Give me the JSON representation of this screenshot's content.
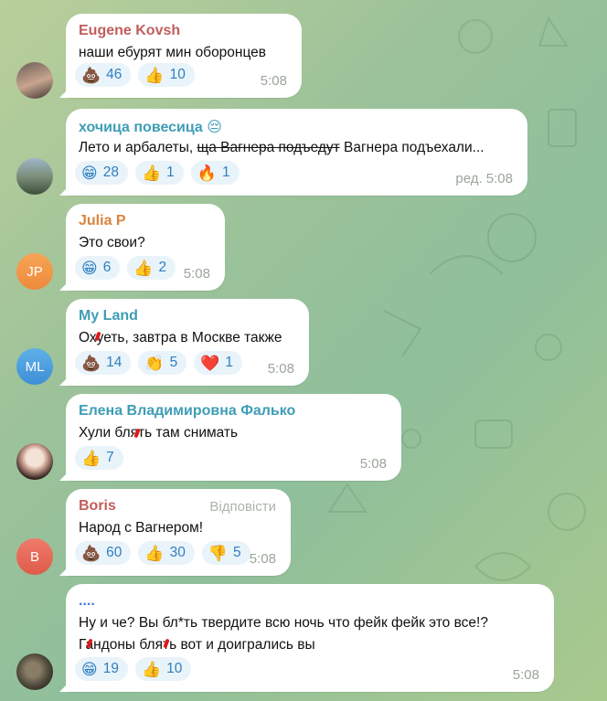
{
  "messages": [
    {
      "name": "Eugene Kovsh",
      "name_color": "#c25d5d",
      "text": "наши ебурят мин оборонцев",
      "reactions": [
        {
          "emoji": "💩",
          "count": "46"
        },
        {
          "emoji": "👍",
          "count": "10"
        }
      ],
      "time": "5:08",
      "avatar_initials": ""
    },
    {
      "name": "хочица повесица 😔",
      "name_color": "#3f9db6",
      "text_before": "Лето и арбалеты, ",
      "text_struck": "ща Вагнера подъедут",
      "text_after": " Вагнера подъехали...",
      "reactions": [
        {
          "emoji": "😁",
          "count": "28"
        },
        {
          "emoji": "👍",
          "count": "1"
        },
        {
          "emoji": "🔥",
          "count": "1"
        }
      ],
      "time": "ред. 5:08",
      "avatar_initials": ""
    },
    {
      "name": "Julia P",
      "name_color": "#d9853d",
      "text": "Это свои?",
      "reactions": [
        {
          "emoji": "😁",
          "count": "6"
        },
        {
          "emoji": "👍",
          "count": "2"
        }
      ],
      "time": "5:08",
      "avatar_initials": "JP"
    },
    {
      "name": "My Land",
      "name_color": "#3f9db6",
      "text": "Охуеть, завтра в Москве также",
      "reactions": [
        {
          "emoji": "💩",
          "count": "14"
        },
        {
          "emoji": "👏",
          "count": "5"
        },
        {
          "emoji": "❤️",
          "count": "1"
        }
      ],
      "time": "5:08",
      "avatar_initials": "ML"
    },
    {
      "name": "Елена Владимировна Фалько",
      "name_color": "#3f9db6",
      "text": "Хули блять там снимать",
      "reactions": [
        {
          "emoji": "👍",
          "count": "7"
        }
      ],
      "time": "5:08",
      "avatar_initials": ""
    },
    {
      "name": "Boris",
      "name_color": "#c25d5d",
      "reply_label": "Відповісти",
      "text": "Народ с Вагнером!",
      "reactions": [
        {
          "emoji": "💩",
          "count": "60"
        },
        {
          "emoji": "👍",
          "count": "30"
        },
        {
          "emoji": "👎",
          "count": "5"
        }
      ],
      "time": "5:08",
      "avatar_initials": "B"
    },
    {
      "name": "....",
      "name_color": "#3f7fcf",
      "text_line1": "Ну и че? Вы бл*ть твердите всю ночь что фейк фейк это все!?",
      "text_line2": "Гандоны блять вот и доигрались вы",
      "reactions": [
        {
          "emoji": "😁",
          "count": "19"
        },
        {
          "emoji": "👍",
          "count": "10"
        }
      ],
      "time": "5:08",
      "avatar_initials": ""
    }
  ]
}
